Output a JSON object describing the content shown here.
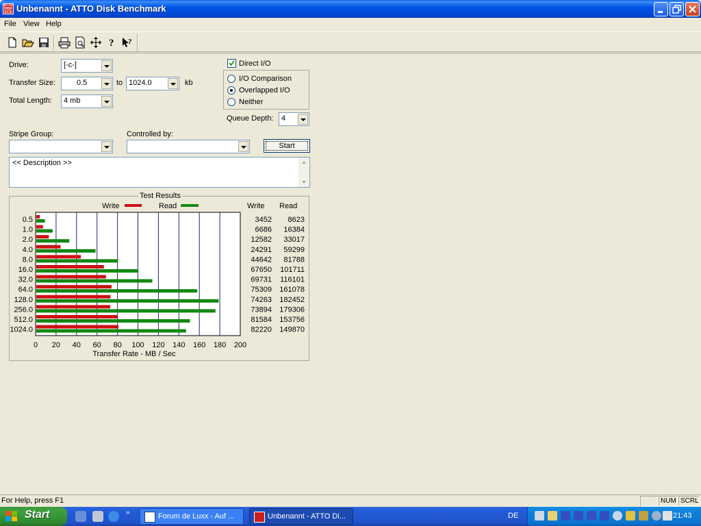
{
  "window": {
    "title": "Unbenannt - ATTO Disk Benchmark",
    "app_icon_text": "ATTO DISK SCSI"
  },
  "menu": [
    "File",
    "View",
    "Help"
  ],
  "toolbar": {
    "icons": [
      "new-icon",
      "open-icon",
      "save-icon",
      "print-icon",
      "print-preview-icon",
      "move-icon",
      "help-icon",
      "context-help-icon"
    ]
  },
  "form": {
    "drive_label": "Drive:",
    "drive_value": "[-c-]",
    "transfer_size_label": "Transfer Size:",
    "transfer_from": "0.5",
    "to_label": "to",
    "transfer_to": "1024.0",
    "kb_label": "kb",
    "total_length_label": "Total Length:",
    "total_length_value": "4 mb",
    "direct_io_label": "Direct I/O",
    "direct_io_checked": true,
    "io_options": [
      {
        "label": "I/O Comparison",
        "selected": false
      },
      {
        "label": "Overlapped I/O",
        "selected": true
      },
      {
        "label": "Neither",
        "selected": false
      }
    ],
    "queue_depth_label": "Queue Depth:",
    "queue_depth_value": "4",
    "stripe_group_label": "Stripe Group:",
    "stripe_group_value": "",
    "controlled_by_label": "Controlled by:",
    "controlled_by_value": "",
    "start_label": "Start",
    "description": "<< Description >>"
  },
  "results": {
    "title": "Test Results",
    "legend_write": "Write",
    "legend_read": "Read",
    "col_write": "Write",
    "col_read": "Read",
    "write_color": "#cc1111",
    "read_color": "#118811"
  },
  "chart_data": {
    "type": "bar",
    "orientation": "horizontal",
    "categories": [
      "0.5",
      "1.0",
      "2.0",
      "4.0",
      "8.0",
      "16.0",
      "32.0",
      "64.0",
      "128.0",
      "256.0",
      "512.0",
      "1024.0"
    ],
    "series": [
      {
        "name": "Write",
        "values": [
          3452,
          6686,
          12582,
          24291,
          44642,
          67650,
          69731,
          75309,
          74263,
          73894,
          81584,
          82220
        ]
      },
      {
        "name": "Read",
        "values": [
          8623,
          16384,
          33017,
          59299,
          81788,
          101711,
          116101,
          161078,
          182452,
          179306,
          153756,
          149870
        ]
      }
    ],
    "unit_values": "KB/s",
    "xlabel": "Transfer Rate - MB / Sec",
    "xticks": [
      "0",
      "20",
      "40",
      "60",
      "80",
      "100",
      "120",
      "140",
      "160",
      "180",
      "200"
    ],
    "xlim": [
      0,
      200
    ],
    "grid": true
  },
  "status": {
    "help_text": "For Help, press F1",
    "num": "NUM",
    "scrl": "SCRL"
  },
  "taskbar": {
    "start_label": "Start",
    "tasks": [
      "Forum de Luxx - Auf ...",
      "Unbenannt - ATTO Di..."
    ],
    "language": "DE",
    "clock": "21:43"
  }
}
